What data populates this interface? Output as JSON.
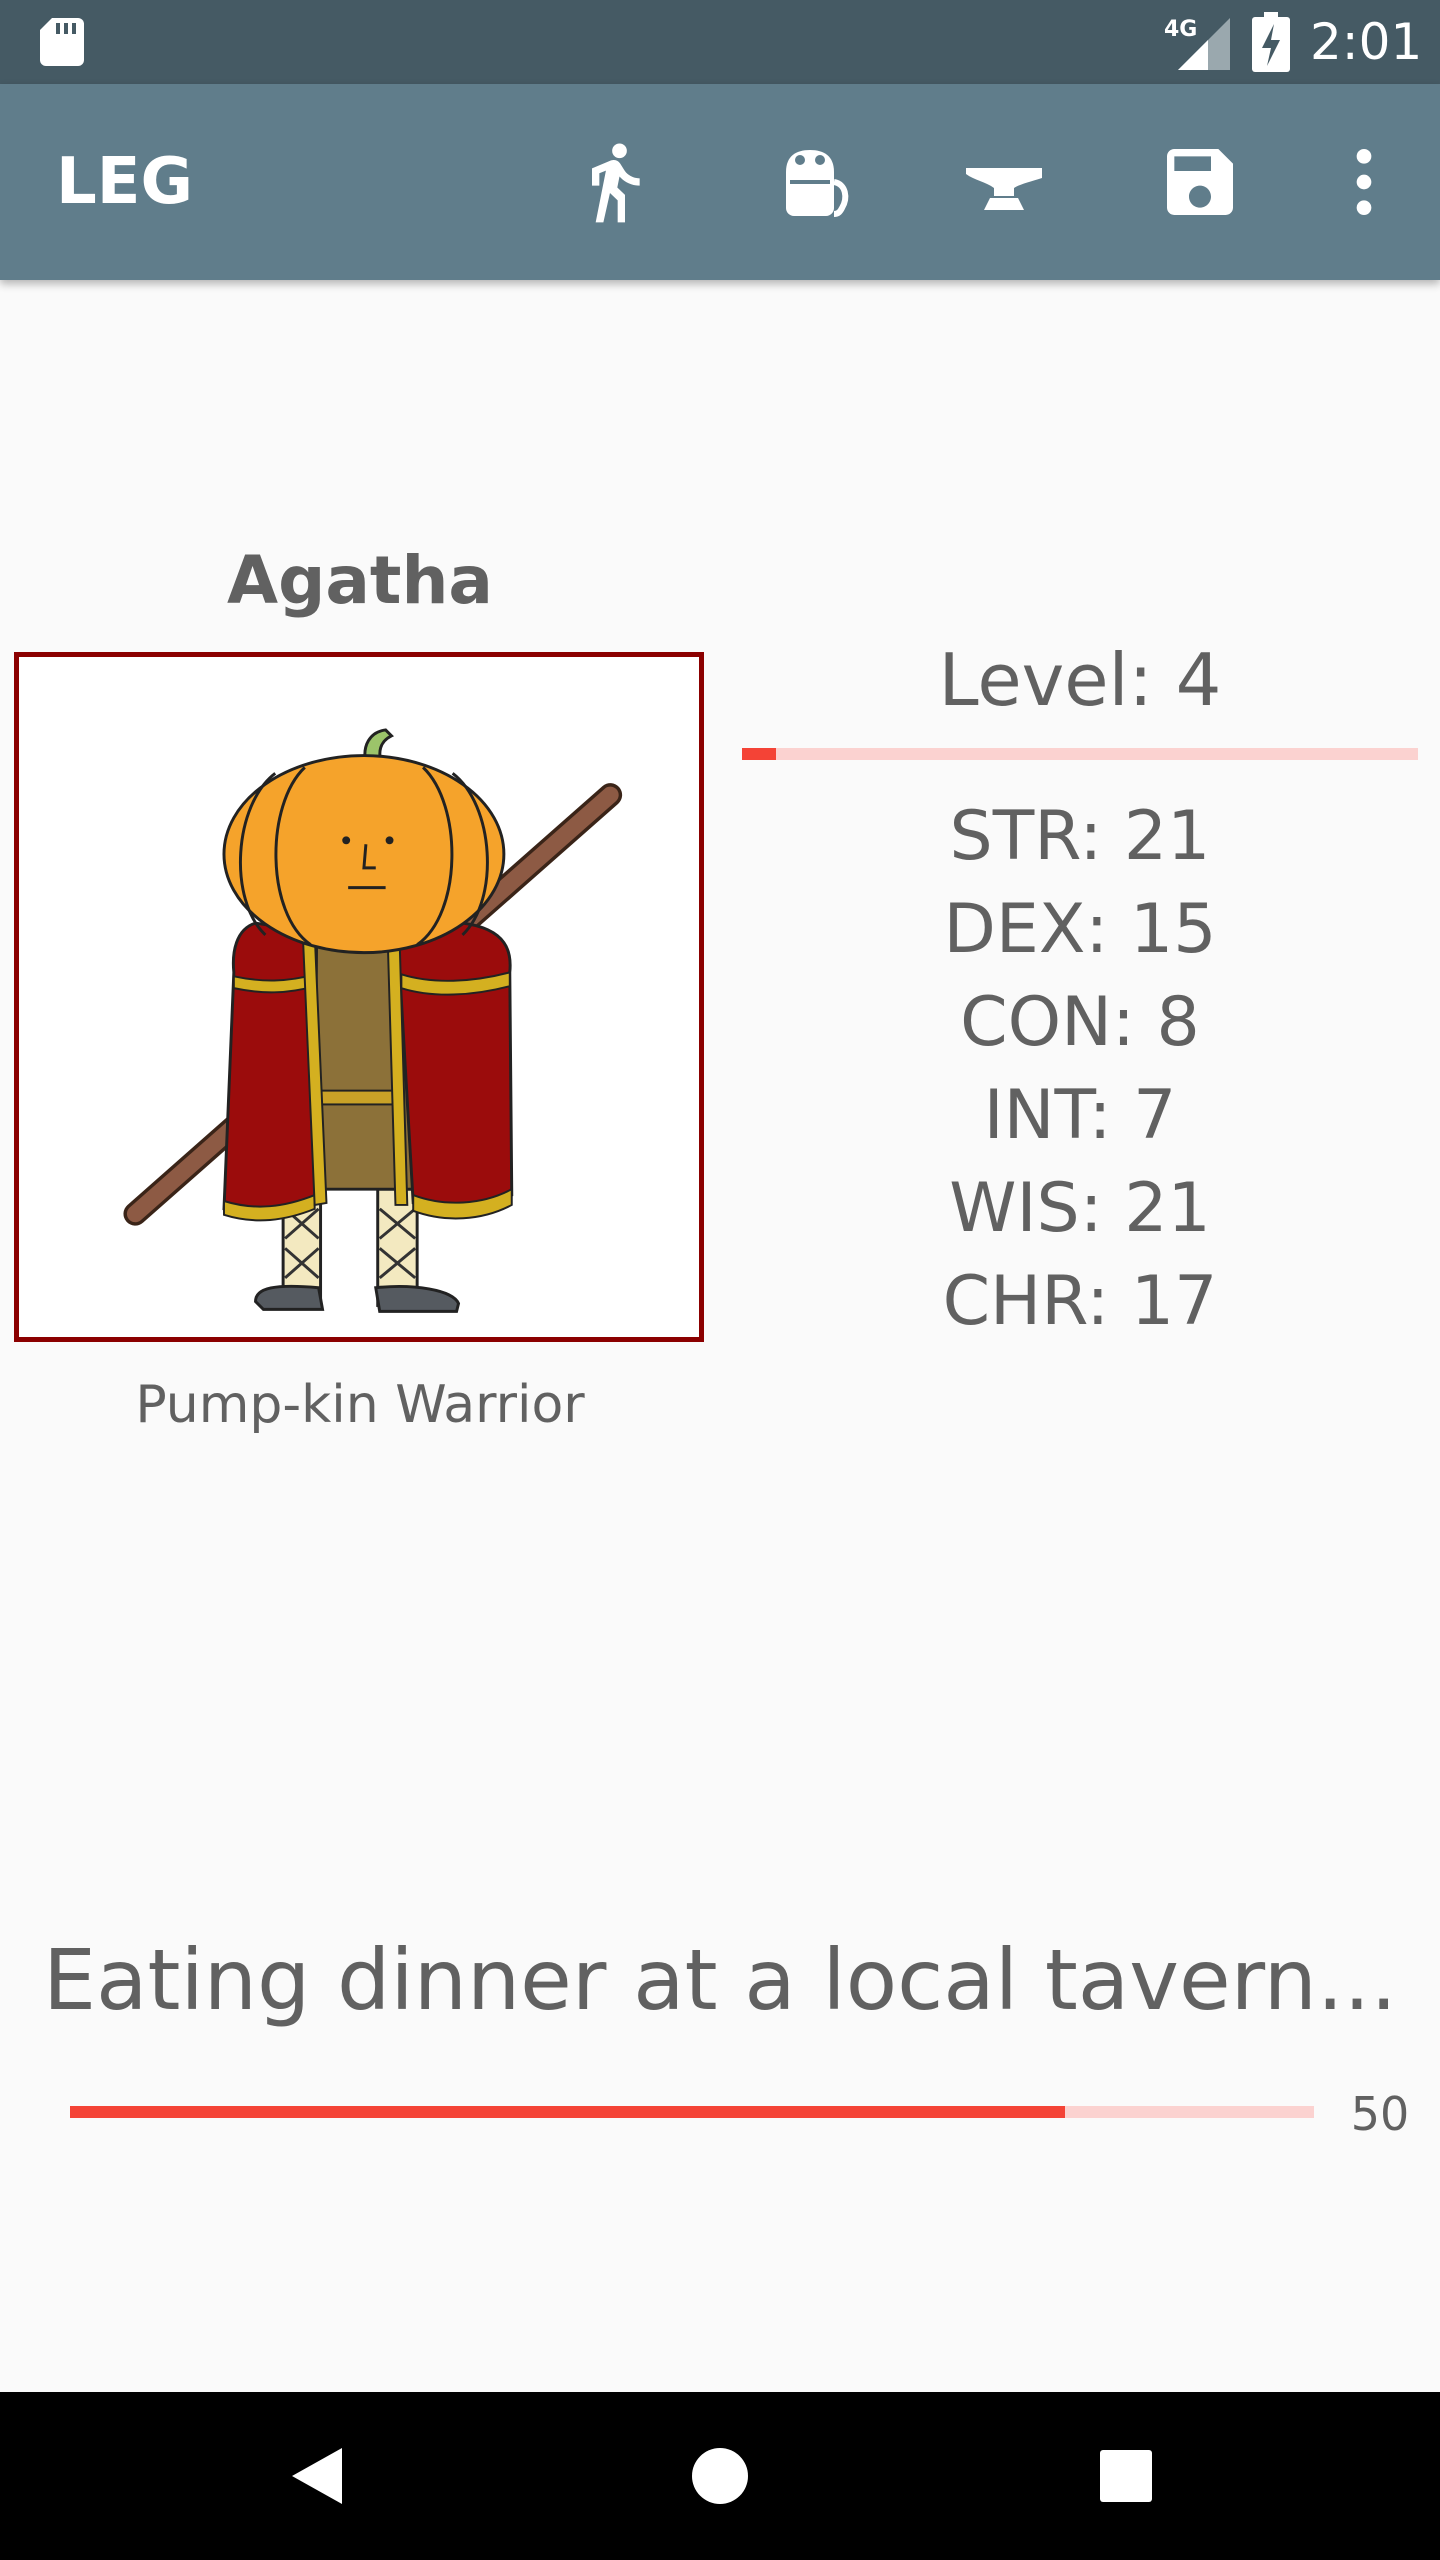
{
  "status_bar": {
    "time": "2:01",
    "network_label": "4G",
    "icons": [
      "sd-card-icon",
      "cellular-signal-icon",
      "battery-charging-icon"
    ]
  },
  "app_bar": {
    "title": "LEG",
    "actions": [
      "walking-person-icon",
      "backpack-icon",
      "anvil-icon",
      "save-icon",
      "more-vert-icon"
    ]
  },
  "character": {
    "name": "Agatha",
    "class": "Pump-kin Warrior",
    "portrait": "pumpkin-warrior-portrait",
    "level_label": "Level: 4",
    "level_progress": 0.05,
    "stats": [
      "STR: 21",
      "DEX: 15",
      "CON: 8",
      "INT: 7",
      "WIS: 21",
      "CHR: 17"
    ]
  },
  "activity": {
    "text": "Eating dinner at a local tavern...",
    "progress": 0.8,
    "count": "50"
  },
  "nav_bar": {
    "buttons": [
      "back-icon",
      "home-icon",
      "recents-icon"
    ]
  },
  "colors": {
    "status_bar": "#455a64",
    "app_bar": "#607d8b",
    "accent": "#f44336",
    "track": "#fbd2d0",
    "portrait_border": "#8b0000"
  }
}
